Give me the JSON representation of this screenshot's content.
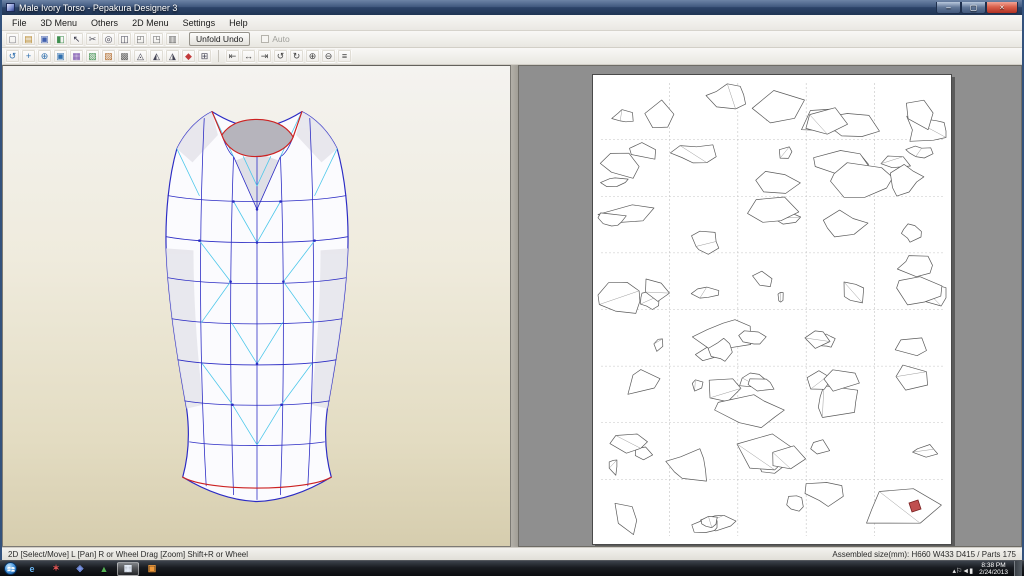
{
  "window": {
    "title": "Male Ivory Torso - Pepakura Designer 3"
  },
  "titlebar": {
    "controls": [
      {
        "name": "minimize-button",
        "glyph": "–"
      },
      {
        "name": "maximize-button",
        "glyph": "▢"
      },
      {
        "name": "close-button",
        "glyph": "×"
      }
    ]
  },
  "menu": {
    "items": [
      {
        "id": "file",
        "label": "File"
      },
      {
        "id": "3d-menu",
        "label": "3D Menu"
      },
      {
        "id": "others",
        "label": "Others"
      },
      {
        "id": "2d-menu",
        "label": "2D Menu"
      },
      {
        "id": "settings",
        "label": "Settings"
      },
      {
        "id": "help",
        "label": "Help"
      }
    ]
  },
  "toolbar_main": {
    "unfold_undo_label": "Unfold Undo",
    "auto_label": "Auto",
    "icons": [
      {
        "name": "new-file-icon",
        "glyph": "▢",
        "color": "#77777f"
      },
      {
        "name": "open-file-icon",
        "glyph": "▤",
        "color": "#b98b2f"
      },
      {
        "name": "save-file-icon",
        "glyph": "▣",
        "color": "#3f5fae"
      },
      {
        "name": "texture-view-icon",
        "glyph": "◧",
        "color": "#3f8f4f"
      },
      {
        "name": "select-tool-icon",
        "glyph": "↖",
        "color": "#333344"
      },
      {
        "name": "cut-tool-icon",
        "glyph": "✂",
        "color": "#555560"
      },
      {
        "name": "zoom-tool-icon",
        "glyph": "◎",
        "color": "#445"
      },
      {
        "name": "measure-tool-icon",
        "glyph": "◫",
        "color": "#445"
      },
      {
        "name": "window-3d-icon",
        "glyph": "◰",
        "color": "#666"
      },
      {
        "name": "window-2d-icon",
        "glyph": "◳",
        "color": "#666"
      },
      {
        "name": "window-both-icon",
        "glyph": "▥",
        "color": "#666"
      }
    ]
  },
  "toolbar_secondary": {
    "left_icons": [
      {
        "name": "rotate-model-icon",
        "glyph": "↺",
        "color": "#2f6fae"
      },
      {
        "name": "pan-model-icon",
        "glyph": "+",
        "color": "#2f6fae"
      },
      {
        "name": "zoom-model-icon",
        "glyph": "⊕",
        "color": "#2f6fae"
      },
      {
        "name": "fit-view-icon",
        "glyph": "▣",
        "color": "#2f6fae"
      },
      {
        "name": "show-edges-icon",
        "glyph": "▦",
        "color": "#7a4fae"
      },
      {
        "name": "show-texture-icon",
        "glyph": "▧",
        "color": "#3f8f4f"
      },
      {
        "name": "show-flaps-icon",
        "glyph": "▨",
        "color": "#b06a2a"
      },
      {
        "name": "show-numbers-icon",
        "glyph": "▩",
        "color": "#666"
      },
      {
        "name": "check-model-icon",
        "glyph": "◬",
        "color": "#445"
      },
      {
        "name": "divide-face-icon",
        "glyph": "◭",
        "color": "#445"
      },
      {
        "name": "join-face-icon",
        "glyph": "◮",
        "color": "#445"
      },
      {
        "name": "edge-color-icon",
        "glyph": "◆",
        "color": "#c23a3a"
      },
      {
        "name": "grid-icon",
        "glyph": "⊞",
        "color": "#445"
      }
    ],
    "right_icons": [
      {
        "name": "align-left-icon",
        "glyph": "⇤",
        "color": "#444"
      },
      {
        "name": "align-center-icon",
        "glyph": "↔",
        "color": "#444"
      },
      {
        "name": "align-right-icon",
        "glyph": "⇥",
        "color": "#444"
      },
      {
        "name": "rotate-left-icon",
        "glyph": "↺",
        "color": "#444"
      },
      {
        "name": "rotate-right-icon",
        "glyph": "↻",
        "color": "#444"
      },
      {
        "name": "zoom-in-icon",
        "glyph": "⊕",
        "color": "#444"
      },
      {
        "name": "zoom-out-icon",
        "glyph": "⊖",
        "color": "#444"
      },
      {
        "name": "arrange-icon",
        "glyph": "≡",
        "color": "#444"
      }
    ]
  },
  "statusbar": {
    "left": "2D [Select/Move] L [Pan] R or Wheel Drag [Zoom] Shift+R or Wheel",
    "right": "Assembled size(mm): H660 W433 D415 / Parts 175"
  },
  "taskbar": {
    "apps": [
      {
        "name": "taskbar-internet-explorer",
        "glyph": "e",
        "color": "#6cb8f5",
        "active": false
      },
      {
        "name": "taskbar-app-red",
        "glyph": "✶",
        "color": "#e05555",
        "active": false
      },
      {
        "name": "taskbar-app-blue",
        "glyph": "◈",
        "color": "#7b97ea",
        "active": false
      },
      {
        "name": "taskbar-app-green",
        "glyph": "▲",
        "color": "#54b254",
        "active": false
      },
      {
        "name": "taskbar-pepakura-designer",
        "glyph": "▦",
        "color": "#e6eefa",
        "active": true
      },
      {
        "name": "taskbar-app-orange",
        "glyph": "▣",
        "color": "#f09a3a",
        "active": false
      }
    ],
    "tray_icons": [
      {
        "name": "tray-expand-icon",
        "glyph": "▴"
      },
      {
        "name": "tray-flag-icon",
        "glyph": "⚐"
      },
      {
        "name": "tray-volume-icon",
        "glyph": "◄"
      },
      {
        "name": "tray-network-icon",
        "glyph": "▮"
      }
    ],
    "time": "8:38 PM",
    "date": "2/24/2013"
  },
  "pattern_page": {
    "rows": 8,
    "cols": 5,
    "seed": 20130224
  }
}
